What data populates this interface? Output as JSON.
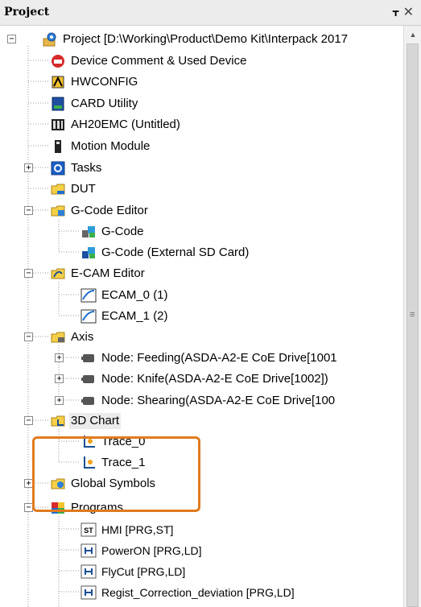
{
  "panel": {
    "title": "Project",
    "pin_icon": "pin-icon",
    "close_icon": "close-icon"
  },
  "tree": {
    "root": "Project [D:\\Working\\Product\\Demo Kit\\Interpack 2017",
    "items": [
      {
        "label": "Device Comment & Used Device",
        "icon": "device-comment-icon"
      },
      {
        "label": "HWCONFIG",
        "icon": "hwconfig-icon"
      },
      {
        "label": "CARD Utility",
        "icon": "card-utility-icon"
      },
      {
        "label": "AH20EMC  (Untitled)",
        "icon": "ah20emc-icon"
      },
      {
        "label": "Motion Module",
        "icon": "motion-module-icon"
      },
      {
        "label": "Tasks",
        "icon": "tasks-icon"
      },
      {
        "label": "DUT",
        "icon": "dut-icon"
      },
      {
        "label": "G-Code Editor",
        "icon": "gcode-editor-icon"
      },
      {
        "label": "G-Code",
        "icon": "gcode-icon"
      },
      {
        "label": "G-Code (External SD Card)",
        "icon": "gcode-sd-icon"
      },
      {
        "label": "E-CAM Editor",
        "icon": "ecam-editor-icon"
      },
      {
        "label": "ECAM_0 (1)",
        "icon": "ecam-curve-icon"
      },
      {
        "label": "ECAM_1 (2)",
        "icon": "ecam-curve-icon"
      },
      {
        "label": "Axis",
        "icon": "axis-folder-icon"
      },
      {
        "label": "Node: Feeding(ASDA-A2-E CoE Drive[1001",
        "icon": "servo-node-icon"
      },
      {
        "label": "Node: Knife(ASDA-A2-E CoE Drive[1002])",
        "icon": "servo-node-icon"
      },
      {
        "label": "Node: Shearing(ASDA-A2-E CoE Drive[100",
        "icon": "servo-node-icon"
      },
      {
        "label": "3D Chart",
        "icon": "chart-folder-icon"
      },
      {
        "label": "Trace_0",
        "icon": "trace-icon"
      },
      {
        "label": "Trace_1",
        "icon": "trace-icon"
      },
      {
        "label": "Global Symbols",
        "icon": "global-symbols-icon"
      },
      {
        "label": "Programs",
        "icon": "programs-icon"
      },
      {
        "label": "HMI [PRG,ST]",
        "icon": "st-program-icon"
      },
      {
        "label": "PowerON [PRG,LD]",
        "icon": "ld-program-icon"
      },
      {
        "label": "FlyCut [PRG,LD]",
        "icon": "ld-program-icon"
      },
      {
        "label": "Regist_Correction_deviation [PRG,LD]",
        "icon": "ld-program-icon"
      }
    ],
    "st_badge": "ST"
  },
  "colors": {
    "highlight_border": "#e07a1f",
    "selected_bg": "#ebebeb"
  }
}
